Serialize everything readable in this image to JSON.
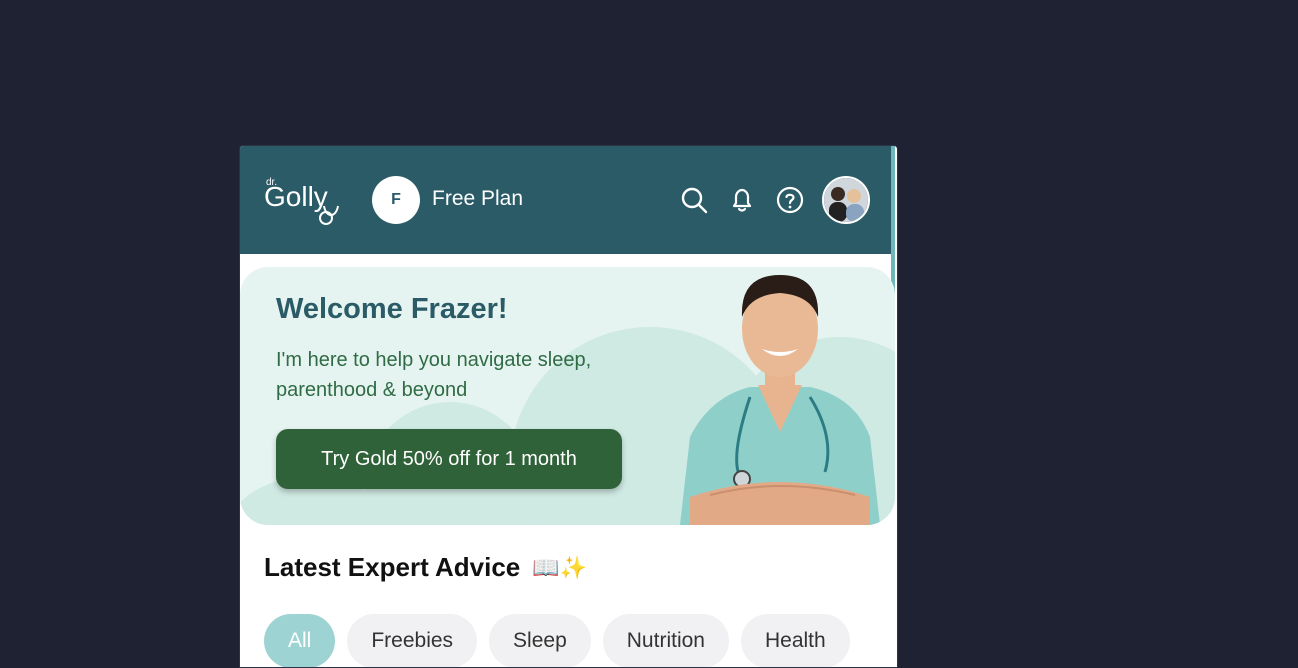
{
  "header": {
    "logo_text": "dr.Golly",
    "plan_initial": "F",
    "plan_label": "Free Plan",
    "icons": [
      "search-icon",
      "bell-icon",
      "help-icon"
    ],
    "colors": {
      "header_bg": "#2a5b67",
      "accent": "#6fb7b8"
    }
  },
  "banner": {
    "title": "Welcome Frazer!",
    "subtitle": "I'm here to help you navigate sleep, parenthood & beyond",
    "cta_label": "Try Gold 50% off for 1 month",
    "colors": {
      "title": "#2a5b67",
      "subtitle": "#2f6b44",
      "cta_bg": "#2f6238",
      "bg": "#e6f4f1"
    }
  },
  "advice": {
    "title": "Latest Expert Advice",
    "emoji": "📖✨",
    "chips": [
      {
        "label": "All",
        "active": true
      },
      {
        "label": "Freebies",
        "active": false
      },
      {
        "label": "Sleep",
        "active": false
      },
      {
        "label": "Nutrition",
        "active": false
      },
      {
        "label": "Health",
        "active": false
      }
    ]
  }
}
